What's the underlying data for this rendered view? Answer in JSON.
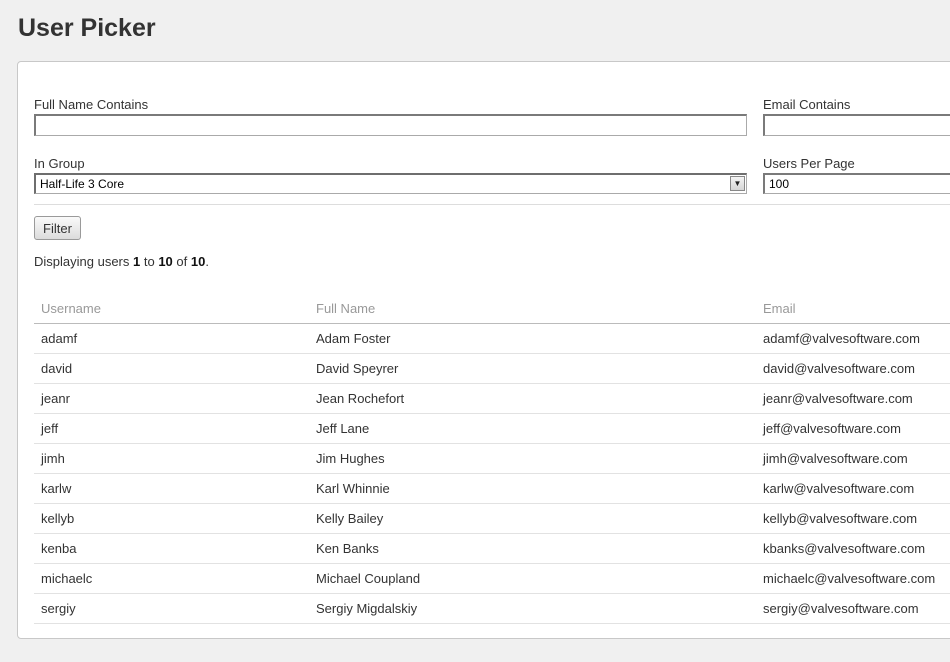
{
  "page": {
    "title": "User Picker"
  },
  "filters": {
    "full_name_label": "Full Name Contains",
    "full_name_value": "",
    "email_label": "Email Contains",
    "email_value": "",
    "group_label": "In Group",
    "group_selected": "Half-Life 3 Core",
    "per_page_label": "Users Per Page",
    "per_page_value": "100",
    "filter_button": "Filter"
  },
  "summary": {
    "prefix": "Displaying users ",
    "from": "1",
    "to_word": " to ",
    "to": "10",
    "of_word": " of ",
    "total": "10",
    "suffix": "."
  },
  "table": {
    "headers": {
      "username": "Username",
      "full_name": "Full Name",
      "email": "Email"
    },
    "rows": [
      {
        "username": "adamf",
        "full_name": "Adam Foster",
        "email": "adamf@valvesoftware.com"
      },
      {
        "username": "david",
        "full_name": "David Speyrer",
        "email": "david@valvesoftware.com"
      },
      {
        "username": "jeanr",
        "full_name": "Jean Rochefort",
        "email": "jeanr@valvesoftware.com"
      },
      {
        "username": "jeff",
        "full_name": "Jeff Lane",
        "email": "jeff@valvesoftware.com"
      },
      {
        "username": "jimh",
        "full_name": "Jim Hughes",
        "email": "jimh@valvesoftware.com"
      },
      {
        "username": "karlw",
        "full_name": "Karl Whinnie",
        "email": "karlw@valvesoftware.com"
      },
      {
        "username": "kellyb",
        "full_name": "Kelly Bailey",
        "email": "kellyb@valvesoftware.com"
      },
      {
        "username": "kenba",
        "full_name": "Ken Banks",
        "email": "kbanks@valvesoftware.com"
      },
      {
        "username": "michaelc",
        "full_name": "Michael Coupland",
        "email": "michaelc@valvesoftware.com"
      },
      {
        "username": "sergiy",
        "full_name": "Sergiy Migdalskiy",
        "email": "sergiy@valvesoftware.com"
      }
    ]
  },
  "icons": {
    "dropdown_arrow": "chevron-down-icon"
  }
}
